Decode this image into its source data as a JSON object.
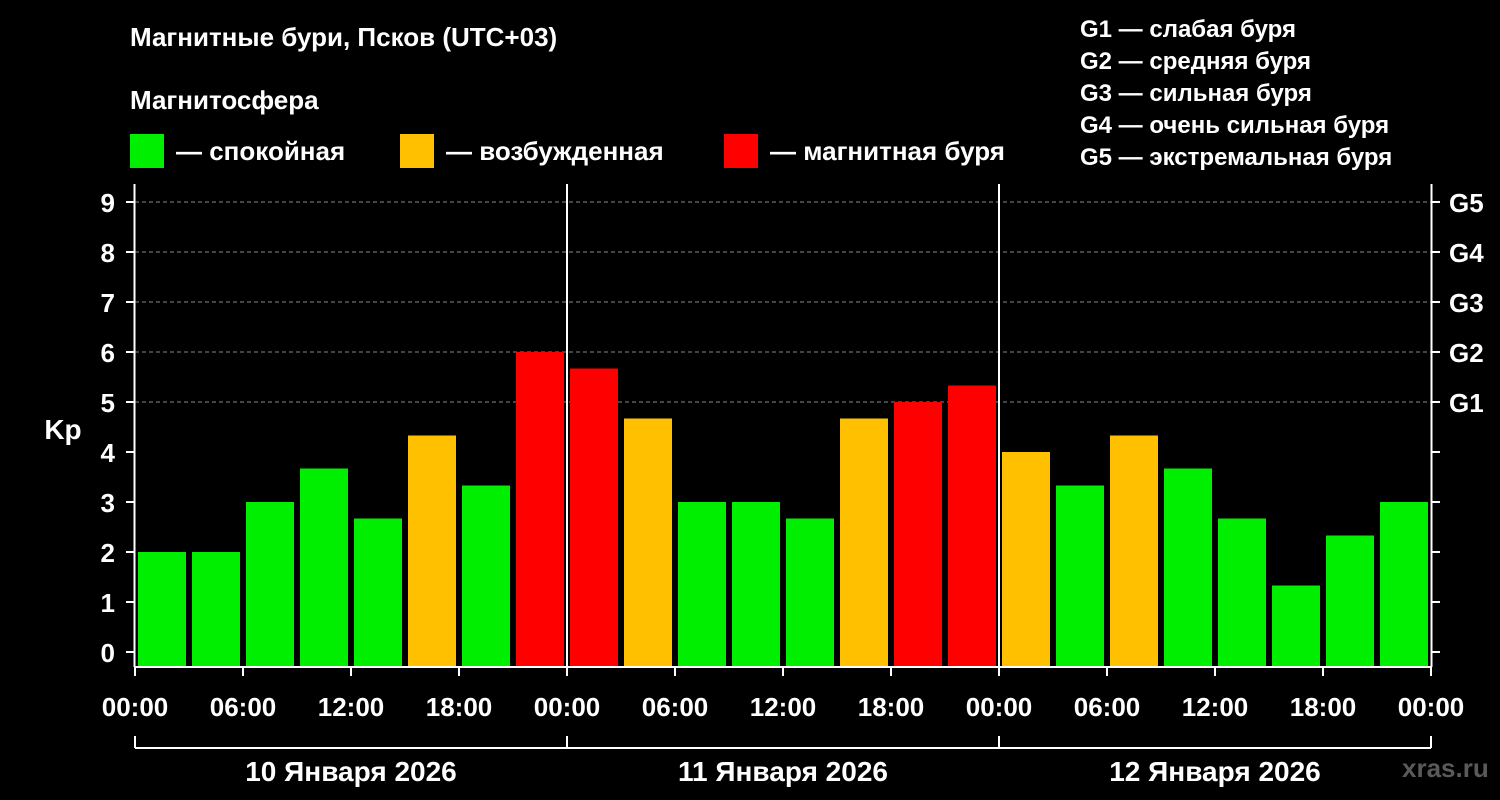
{
  "title": "Магнитные бури, Псков (UTC+03)",
  "subtitle": "Магнитосфера",
  "state_legend": [
    {
      "label": "— спокойная",
      "color": "#00ee00"
    },
    {
      "label": "— возбужденная",
      "color": "#ffc000"
    },
    {
      "label": "— магнитная буря",
      "color": "#ff0000"
    }
  ],
  "g_legend": [
    "G1 — слабая буря",
    "G2 — средняя буря",
    "G3 — сильная буря",
    "G4 — очень сильная буря",
    "G5 — экстремальная буря"
  ],
  "watermark": "xras.ru",
  "colors": {
    "quiet": "#00ee00",
    "active": "#ffc000",
    "storm": "#ff0000",
    "background": "#000000",
    "grid": "#888888"
  },
  "chart_data": {
    "type": "bar",
    "ylabel": "Kp",
    "ylim": [
      0,
      9
    ],
    "y_ticks": [
      0,
      1,
      2,
      3,
      4,
      5,
      6,
      7,
      8,
      9
    ],
    "right_axis_labels": [
      {
        "kp": 5,
        "label": "G1"
      },
      {
        "kp": 6,
        "label": "G2"
      },
      {
        "kp": 7,
        "label": "G3"
      },
      {
        "kp": 8,
        "label": "G4"
      },
      {
        "kp": 9,
        "label": "G5"
      }
    ],
    "x_tick_labels": [
      "00:00",
      "06:00",
      "12:00",
      "18:00",
      "00:00",
      "06:00",
      "12:00",
      "18:00",
      "00:00",
      "06:00",
      "12:00",
      "18:00",
      "00:00"
    ],
    "days": [
      "10 Января 2026",
      "11 Января 2026",
      "12 Января 2026"
    ],
    "grid": "dashed horizontal at Kp 5-9",
    "values": [
      2.0,
      2.0,
      3.0,
      3.67,
      2.67,
      4.33,
      3.33,
      6.0,
      5.67,
      4.67,
      3.0,
      3.0,
      2.67,
      4.67,
      5.0,
      5.33,
      4.0,
      3.33,
      4.33,
      3.67,
      2.67,
      1.33,
      2.33,
      3.0
    ],
    "states": [
      "quiet",
      "quiet",
      "quiet",
      "quiet",
      "quiet",
      "active",
      "quiet",
      "storm",
      "storm",
      "active",
      "quiet",
      "quiet",
      "quiet",
      "active",
      "storm",
      "storm",
      "active",
      "quiet",
      "active",
      "quiet",
      "quiet",
      "quiet",
      "quiet",
      "quiet"
    ]
  }
}
